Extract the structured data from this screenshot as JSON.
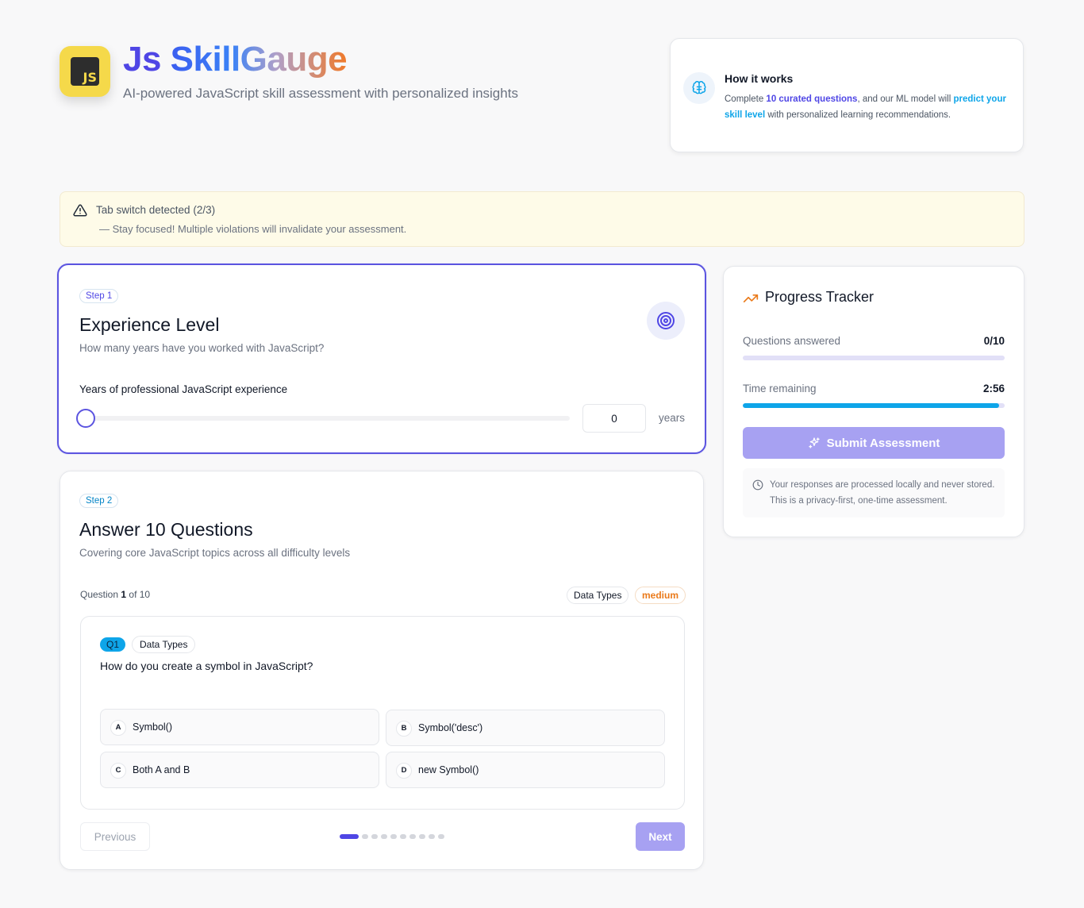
{
  "header": {
    "logo_text": "JS",
    "title_prefix": "Js ",
    "title_main": "SkillGauge",
    "subtitle": "AI-powered JavaScript skill assessment with personalized insights"
  },
  "how_it_works": {
    "title": "How it works",
    "text_1": "Complete ",
    "highlight_1": "10 curated questions",
    "text_2": ", and our ML model will ",
    "highlight_2": "predict your skill level",
    "text_3": " with personalized learning recommendations."
  },
  "warning": {
    "title": "Tab switch detected (2/3)",
    "message": "— Stay focused! Multiple violations will invalidate your assessment."
  },
  "step1": {
    "pill": "Step 1",
    "title": "Experience Level",
    "subtitle": "How many years have you worked with JavaScript?",
    "field_label": "Years of professional JavaScript experience",
    "slider_value": 0,
    "input_value": "0",
    "unit": "years"
  },
  "step2": {
    "pill": "Step 2",
    "title": "Answer 10 Questions",
    "subtitle": "Covering core JavaScript topics across all difficulty levels",
    "meta_prefix": "Question ",
    "meta_current": "1",
    "meta_suffix": " of 10",
    "topic_tag": "Data Types",
    "difficulty_tag": "medium",
    "question": {
      "number": "Q1",
      "topic": "Data Types",
      "text": "How do you create a symbol in JavaScript?",
      "options": [
        {
          "letter": "A",
          "text": "Symbol()"
        },
        {
          "letter": "B",
          "text": "Symbol('desc')"
        },
        {
          "letter": "C",
          "text": "Both A and B"
        },
        {
          "letter": "D",
          "text": "new Symbol()"
        }
      ]
    },
    "prev_label": "Previous",
    "next_label": "Next",
    "total_questions": 10,
    "current_index": 0
  },
  "tracker": {
    "title": "Progress Tracker",
    "answered_label": "Questions answered",
    "answered_value": "0/10",
    "answered_fraction": 0,
    "time_label": "Time remaining",
    "time_value": "2:56",
    "time_fraction": 0.98,
    "submit_label": "Submit Assessment",
    "privacy_text": "Your responses are processed locally and never stored. This is a privacy-first, one-time assessment."
  },
  "colors": {
    "accent": "#4f46e5",
    "sky": "#0ea5e9",
    "warning_bg": "#fefbe8",
    "disabled_button": "#a7a1f2",
    "logo_bg": "#f5d94a"
  },
  "icons": {
    "logo": "js-logo-icon",
    "how": "brain-icon",
    "warning": "warning-triangle-icon",
    "target": "target-icon",
    "tracker": "trending-up-icon",
    "submit": "sparkles-icon",
    "privacy": "clock-icon"
  }
}
